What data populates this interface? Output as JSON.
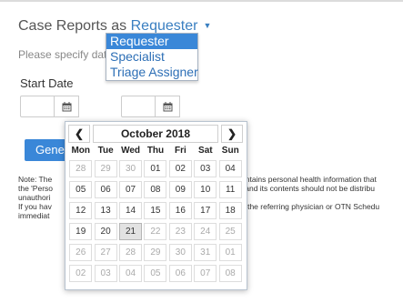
{
  "header": {
    "title_prefix": "Case Reports as",
    "role_selected": "Requester",
    "caret": "▼"
  },
  "role_dropdown": {
    "options": [
      "Requester",
      "Specialist",
      "Triage Assigner"
    ],
    "selected_index": 0
  },
  "form": {
    "hint": "Please specify dat",
    "start_label": "Start Date",
    "start_value": "",
    "end_value": "",
    "calendar_icon": "calendar-icon",
    "generate_label": "Generate"
  },
  "note": {
    "left_lines": [
      "Note: The",
      "the 'Perso",
      "unauthori",
      "If you hav",
      "immediat"
    ],
    "right_lines": [
      "ontains personal health information that",
      "i and its contents should not be distribu",
      "",
      ":t the referring physician or OTN Schedu",
      ""
    ]
  },
  "calendar": {
    "month_label": "October 2018",
    "prev": "❮",
    "next": "❯",
    "weekdays": [
      "Mon",
      "Tue",
      "Wed",
      "Thu",
      "Fri",
      "Sat",
      "Sun"
    ],
    "weeks": [
      [
        "28",
        "29",
        "30",
        "01",
        "02",
        "03",
        "04"
      ],
      [
        "05",
        "06",
        "07",
        "08",
        "09",
        "10",
        "11"
      ],
      [
        "12",
        "13",
        "14",
        "15",
        "16",
        "17",
        "18"
      ],
      [
        "19",
        "20",
        "21",
        "22",
        "23",
        "24",
        "25"
      ],
      [
        "26",
        "27",
        "28",
        "29",
        "30",
        "31",
        "01"
      ],
      [
        "02",
        "03",
        "04",
        "05",
        "06",
        "07",
        "08"
      ]
    ],
    "today": "21"
  }
}
